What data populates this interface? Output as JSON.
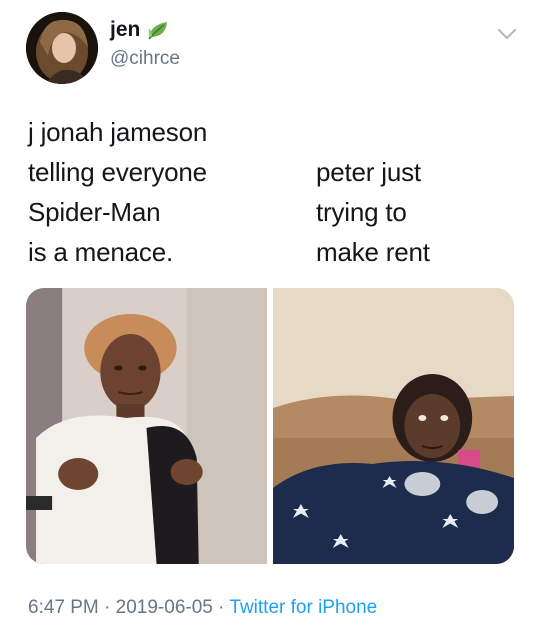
{
  "user": {
    "display_name": "jen",
    "handle": "@cihrce",
    "name_emoji_icon": "leaf-icon"
  },
  "tweet": {
    "left_text_lines": [
      "j jonah jameson",
      "telling everyone",
      "Spider-Man",
      "is a menace."
    ],
    "right_text_lines": [
      "peter just",
      "trying to",
      "make rent"
    ]
  },
  "footer": {
    "time": "6:47 PM",
    "separator": "·",
    "date": "2019-06-05",
    "source": "Twitter for iPhone"
  },
  "colors": {
    "text": "#14171a",
    "muted": "#657786",
    "link": "#1da1f2"
  }
}
